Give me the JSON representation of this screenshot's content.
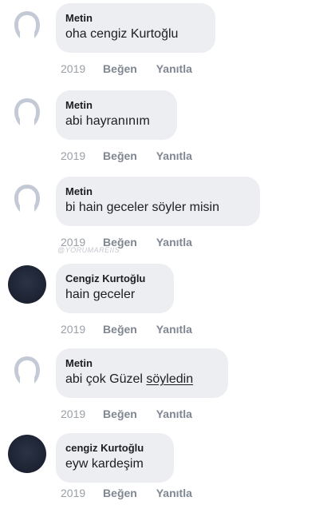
{
  "comments": [
    {
      "author": "Metin",
      "text": "oha cengiz Kurtoğlu",
      "text_underlined": "",
      "avatar": "default-avatar",
      "year": "2019",
      "like_label": "Beğen",
      "reply_label": "Yanıtla"
    },
    {
      "author": "Metin",
      "text": "abi hayranınım",
      "text_underlined": "",
      "avatar": "default-avatar",
      "year": "2019",
      "like_label": "Beğen",
      "reply_label": "Yanıtla"
    },
    {
      "author": "Metin",
      "text": "bi hain geceler söyler misin",
      "text_underlined": "",
      "avatar": "default-avatar",
      "year": "2019",
      "like_label": "Beğen",
      "reply_label": "Yanıtla"
    },
    {
      "author": "Cengiz Kurtoğlu",
      "text": "hain geceler",
      "text_underlined": "",
      "avatar": "dark-photo-avatar",
      "year": "2019",
      "like_label": "Beğen",
      "reply_label": "Yanıtla"
    },
    {
      "author": "Metin",
      "text": "abi çok Güzel ",
      "text_underlined": "söyledin",
      "avatar": "default-avatar",
      "year": "2019",
      "like_label": "Beğen",
      "reply_label": "Yanıtla"
    },
    {
      "author": "cengiz Kurtoğlu",
      "text": "eyw kardeşim",
      "text_underlined": "",
      "avatar": "dark-photo-avatar",
      "year": "2019",
      "like_label": "Beğen",
      "reply_label": "Yanıtla"
    }
  ],
  "watermark": "@YORUMAREIIS",
  "colors": {
    "bubble_bg": "#eceef2",
    "text": "#1c1e21",
    "meta_text": "#8d949e",
    "default_avatar_fill": "#c3cad6",
    "dark_avatar_fill": "#1c2231"
  }
}
